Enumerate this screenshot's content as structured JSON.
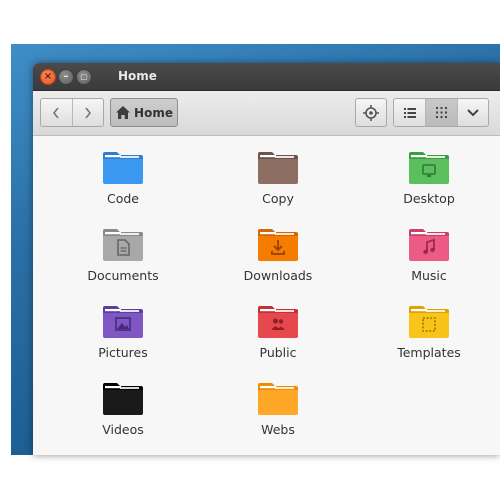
{
  "window": {
    "title": "Home"
  },
  "toolbar": {
    "home_label": "Home"
  },
  "folders": [
    {
      "label": "Code",
      "color": "#3a98f0",
      "dark": "#2d7fd0",
      "glyph": "none"
    },
    {
      "label": "Copy",
      "color": "#8d6e63",
      "dark": "#6d534b",
      "glyph": "none"
    },
    {
      "label": "Desktop",
      "color": "#5bbf5e",
      "dark": "#3e9c44",
      "glyph": "desktop-icon"
    },
    {
      "label": "Documents",
      "color": "#a8a8a8",
      "dark": "#8a8a8a",
      "glyph": "document-icon"
    },
    {
      "label": "Downloads",
      "color": "#f57c00",
      "dark": "#d66600",
      "glyph": "download-icon"
    },
    {
      "label": "Music",
      "color": "#ec5a86",
      "dark": "#c9406a",
      "glyph": "music-note-icon"
    },
    {
      "label": "Pictures",
      "color": "#7e57c2",
      "dark": "#5f3ea3",
      "glyph": "picture-icon"
    },
    {
      "label": "Public",
      "color": "#e5484d",
      "dark": "#c53035",
      "glyph": "people-icon"
    },
    {
      "label": "Templates",
      "color": "#f9c419",
      "dark": "#dca400",
      "glyph": "template-icon"
    },
    {
      "label": "Videos",
      "color": "#1a1a1a",
      "dark": "#000000",
      "glyph": "none"
    },
    {
      "label": "Webs",
      "color": "#ffa726",
      "dark": "#f08c00",
      "glyph": "none"
    }
  ]
}
